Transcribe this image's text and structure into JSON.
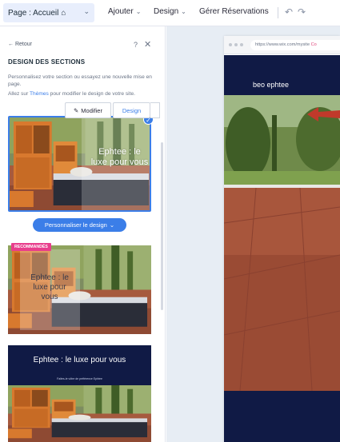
{
  "topbar": {
    "page_select": "Page : Accueil",
    "menus": [
      {
        "label": "Ajouter"
      },
      {
        "label": "Design"
      },
      {
        "label": "Gérer Réservations"
      }
    ]
  },
  "panel": {
    "back": "← Retour",
    "title": "DESIGN DES SECTIONS",
    "desc": "Personnalisez votre section ou essayez une nouvelle mise en page.",
    "desc2_pre": "Allez sur ",
    "desc2_link": "Thèmes",
    "desc2_post": " pour modifier le design de votre site.",
    "customize_button": "Personnaliser le design",
    "recommended_badge": "RECOMMANDÉS",
    "cards": [
      {
        "overlay_text": "Ephtee : le luxe pour vous"
      },
      {
        "overlay_text": "Ephtee : le luxe pour vous"
      },
      {
        "title": "Ephtee : le luxe pour vous",
        "subtitle": "Faites-le vôtre de préférence Ephtee"
      }
    ]
  },
  "canvas": {
    "url": "https://www.wix.com/mysite",
    "url_suffix": "Co",
    "site_name": "beo ephtee",
    "modify_button": "Modifier",
    "design_button": "Design"
  },
  "colors": {
    "accent": "#3b7ee8",
    "navy": "#101a45",
    "badge": "#e83e8c",
    "annotation_arrow": "#c0392b"
  }
}
